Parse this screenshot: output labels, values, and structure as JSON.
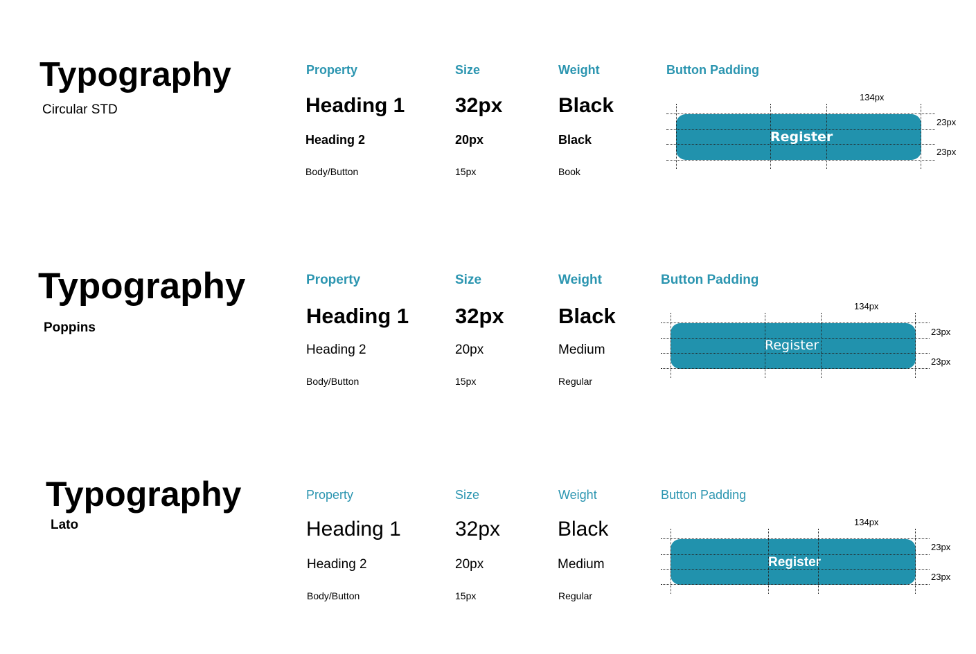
{
  "sections": [
    {
      "title": "Typography",
      "font_name": "Circular STD",
      "headers": {
        "property": "Property",
        "size": "Size",
        "weight": "Weight",
        "button_padding": "Button Padding"
      },
      "rows": [
        {
          "property": "Heading 1",
          "size": "32px",
          "weight": "Black"
        },
        {
          "property": "Heading 2",
          "size": "20px",
          "weight": "Black"
        },
        {
          "property": "Body/Button",
          "size": "15px",
          "weight": "Book"
        }
      ],
      "button": {
        "label": "Register",
        "width_label": "134px",
        "top_padding_label": "23px",
        "bottom_padding_label": "23px"
      }
    },
    {
      "title": "Typography",
      "font_name": "Poppins",
      "headers": {
        "property": "Property",
        "size": "Size",
        "weight": "Weight",
        "button_padding": "Button Padding"
      },
      "rows": [
        {
          "property": "Heading 1",
          "size": "32px",
          "weight": "Black"
        },
        {
          "property": "Heading 2",
          "size": "20px",
          "weight": "Medium"
        },
        {
          "property": "Body/Button",
          "size": "15px",
          "weight": "Regular"
        }
      ],
      "button": {
        "label": "Register",
        "width_label": "134px",
        "top_padding_label": "23px",
        "bottom_padding_label": "23px"
      }
    },
    {
      "title": "Typography",
      "font_name": "Lato",
      "headers": {
        "property": "Property",
        "size": "Size",
        "weight": "Weight",
        "button_padding": "Button Padding"
      },
      "rows": [
        {
          "property": "Heading 1",
          "size": "32px",
          "weight": "Black"
        },
        {
          "property": "Heading 2",
          "size": "20px",
          "weight": "Medium"
        },
        {
          "property": "Body/Button",
          "size": "15px",
          "weight": "Regular"
        }
      ],
      "button": {
        "label": "Register",
        "width_label": "134px",
        "top_padding_label": "23px",
        "bottom_padding_label": "23px"
      }
    }
  ],
  "colors": {
    "accent": "#2b95b0",
    "button": "#2192ad",
    "text": "#000000",
    "background": "#ffffff"
  }
}
